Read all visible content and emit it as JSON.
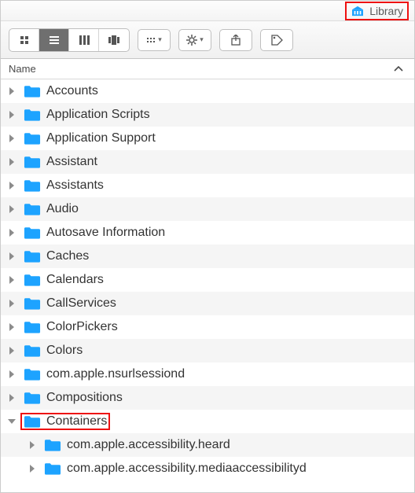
{
  "title": {
    "folder_name": "Library"
  },
  "header": {
    "name_label": "Name"
  },
  "items": [
    {
      "label": "Accounts",
      "expanded": false,
      "depth": 0
    },
    {
      "label": "Application Scripts",
      "expanded": false,
      "depth": 0
    },
    {
      "label": "Application Support",
      "expanded": false,
      "depth": 0
    },
    {
      "label": "Assistant",
      "expanded": false,
      "depth": 0
    },
    {
      "label": "Assistants",
      "expanded": false,
      "depth": 0
    },
    {
      "label": "Audio",
      "expanded": false,
      "depth": 0
    },
    {
      "label": "Autosave Information",
      "expanded": false,
      "depth": 0
    },
    {
      "label": "Caches",
      "expanded": false,
      "depth": 0
    },
    {
      "label": "Calendars",
      "expanded": false,
      "depth": 0
    },
    {
      "label": "CallServices",
      "expanded": false,
      "depth": 0
    },
    {
      "label": "ColorPickers",
      "expanded": false,
      "depth": 0
    },
    {
      "label": "Colors",
      "expanded": false,
      "depth": 0
    },
    {
      "label": "com.apple.nsurlsessiond",
      "expanded": false,
      "depth": 0
    },
    {
      "label": "Compositions",
      "expanded": false,
      "depth": 0
    },
    {
      "label": "Containers",
      "expanded": true,
      "depth": 0,
      "highlighted": true
    },
    {
      "label": "com.apple.accessibility.heard",
      "expanded": false,
      "depth": 1
    },
    {
      "label": "com.apple.accessibility.mediaaccessibilityd",
      "expanded": false,
      "depth": 1
    }
  ]
}
